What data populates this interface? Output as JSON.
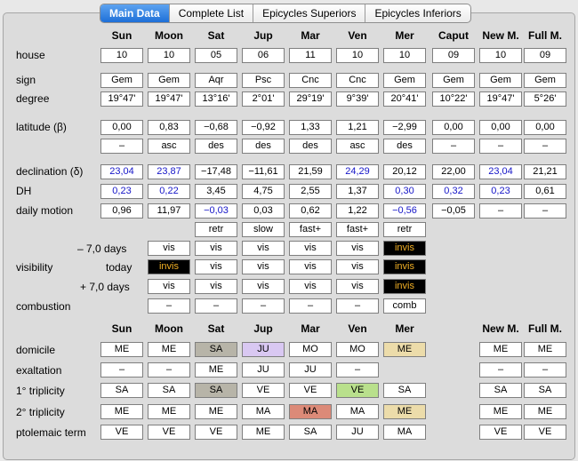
{
  "tabs": [
    "Main Data",
    "Complete List",
    "Epicycles Superiors",
    "Epicycles Inferiors"
  ],
  "planets": [
    "Sun",
    "Moon",
    "Sat",
    "Jup",
    "Mar",
    "Ven",
    "Mer",
    "Caput",
    "New M.",
    "Full M."
  ],
  "planets2": [
    "Sun",
    "Moon",
    "Sat",
    "Jup",
    "Mar",
    "Ven",
    "Mer",
    "",
    "New M.",
    "Full M."
  ],
  "labels": {
    "house": "house",
    "sign": "sign",
    "degree": "degree",
    "latitude": "latitude (β)",
    "declination": "declination (δ)",
    "dh": "DH",
    "daily": "daily motion",
    "visibility": "visibility",
    "minus7": "– 7,0 days",
    "today": "today",
    "plus7": "+ 7,0 days",
    "combustion": "combustion",
    "domicile": "domicile",
    "exaltation": "exaltation",
    "trip1": "1° triplicity",
    "trip2": "2° triplicity",
    "ptolemaic": "ptolemaic term"
  },
  "rows": {
    "house": [
      "10",
      "10",
      "05",
      "06",
      "11",
      "10",
      "10",
      "09",
      "10",
      "09"
    ],
    "sign": [
      "Gem",
      "Gem",
      "Aqr",
      "Psc",
      "Cnc",
      "Cnc",
      "Gem",
      "Gem",
      "Gem",
      "Gem"
    ],
    "degree": [
      "19°47'",
      "19°47'",
      "13°16'",
      "2°01'",
      "29°19'",
      "9°39'",
      "20°41'",
      "10°22'",
      "19°47'",
      "5°26'"
    ],
    "latitude": [
      "0,00",
      "0,83",
      "−0,68",
      "−0,92",
      "1,33",
      "1,21",
      "−2,99",
      "0,00",
      "0,00",
      "0,00"
    ],
    "lat_dir": [
      "–",
      "asc",
      "des",
      "des",
      "des",
      "asc",
      "des",
      "–",
      "–",
      "–"
    ],
    "declination": [
      "23,04",
      "23,87",
      "−17,48",
      "−11,61",
      "21,59",
      "24,29",
      "20,12",
      "22,00",
      "23,04",
      "21,21"
    ],
    "dh": [
      "0,23",
      "0,22",
      "3,45",
      "4,75",
      "2,55",
      "1,37",
      "0,30",
      "0,32",
      "0,23",
      "0,61"
    ],
    "daily": [
      "0,96",
      "11,97",
      "−0,03",
      "0,03",
      "0,62",
      "1,22",
      "−0,56",
      "−0,05",
      "–",
      "–"
    ],
    "motion_state": [
      "retr",
      "slow",
      "fast+",
      "fast+",
      "retr"
    ],
    "vis_minus": [
      "vis",
      "vis",
      "vis",
      "vis",
      "vis",
      "invis"
    ],
    "vis_today": [
      "invis",
      "vis",
      "vis",
      "vis",
      "vis",
      "invis"
    ],
    "vis_plus": [
      "vis",
      "vis",
      "vis",
      "vis",
      "vis",
      "invis"
    ],
    "combustion": [
      "–",
      "–",
      "–",
      "–",
      "–",
      "comb"
    ],
    "domicile": [
      "ME",
      "ME",
      "SA",
      "JU",
      "MO",
      "MO",
      "ME",
      "ME",
      "ME"
    ],
    "exaltation": [
      "–",
      "–",
      "ME",
      "JU",
      "JU",
      "–",
      "–",
      "–"
    ],
    "trip1": [
      "SA",
      "SA",
      "SA",
      "VE",
      "VE",
      "VE",
      "SA",
      "SA",
      "SA"
    ],
    "trip2": [
      "ME",
      "ME",
      "ME",
      "MA",
      "MA",
      "MA",
      "ME",
      "ME",
      "ME"
    ],
    "ptolemaic": [
      "VE",
      "VE",
      "VE",
      "ME",
      "SA",
      "JU",
      "MA",
      "VE",
      "VE"
    ]
  },
  "colors": {
    "blue_text": "#1515c8",
    "invis_bg": "#000000",
    "invis_text": "#f2b025",
    "sa_hl": "#b7b4a8",
    "ju_hl": "#d9c8f2",
    "me_hl": "#ecdcaa",
    "ve_hl": "#b9e08c",
    "ma_hl": "#dc8a78"
  }
}
